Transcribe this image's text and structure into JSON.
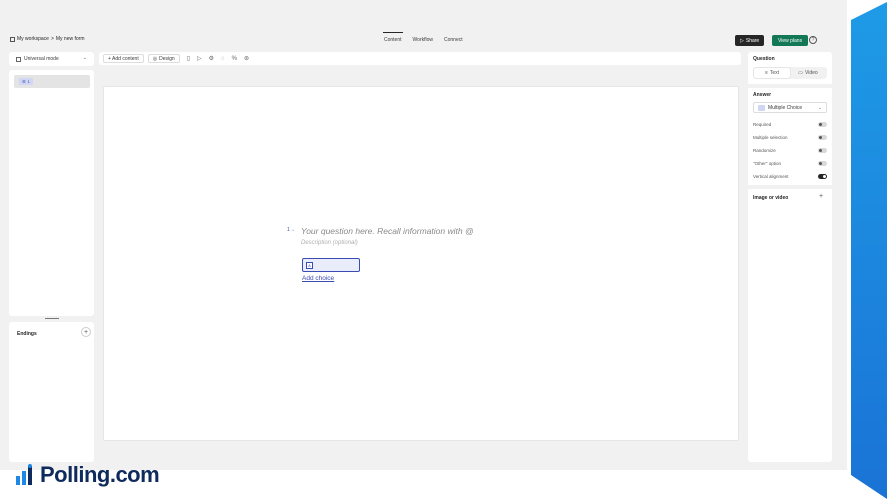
{
  "breadcrumb": {
    "workspace": "My workspace",
    "separator": ">",
    "form": "My new form"
  },
  "header": {
    "tabs": [
      {
        "label": "Content",
        "active": true
      },
      {
        "label": "Workflow",
        "active": false
      },
      {
        "label": "Connect",
        "active": false
      }
    ],
    "share_label": "Share",
    "plans_label": "View plans",
    "help_icon": "question-circle-icon"
  },
  "left": {
    "mode_label": "Universal mode",
    "question_number": "1",
    "endings_label": "Endings",
    "endings_add": "+"
  },
  "toolbar": {
    "add_content_label": "+ Add content",
    "design_label": "Design",
    "icons": [
      "mobile-icon",
      "play-icon",
      "gear-icon",
      "chat-icon",
      "translate-icon",
      "settings-icon"
    ]
  },
  "canvas": {
    "question_number": "1",
    "arrow": "→",
    "question_placeholder": "Your question here. Recall information with @",
    "description_placeholder": "Description (optional)",
    "choice_key": "A",
    "add_choice": "Add choice"
  },
  "right": {
    "question_title": "Question",
    "seg_text": "Text",
    "seg_video": "Video",
    "answer_title": "Answer",
    "answer_type": "Multiple Choice",
    "options": [
      {
        "label": "Required",
        "on": false
      },
      {
        "label": "Multiple selection",
        "on": false
      },
      {
        "label": "Randomize",
        "on": false
      },
      {
        "label": "\"Other\" option",
        "on": false
      },
      {
        "label": "Vertical alignment",
        "on": true
      }
    ],
    "image_label": "Image or video",
    "image_add": "+"
  },
  "brand": {
    "name": "Polling.com",
    "color": "#0f2a5c",
    "accent": "#1e88e5"
  },
  "colors": {
    "primary_green": "#137856",
    "accent_blue": "#3b4bb4",
    "dark": "#262627"
  }
}
